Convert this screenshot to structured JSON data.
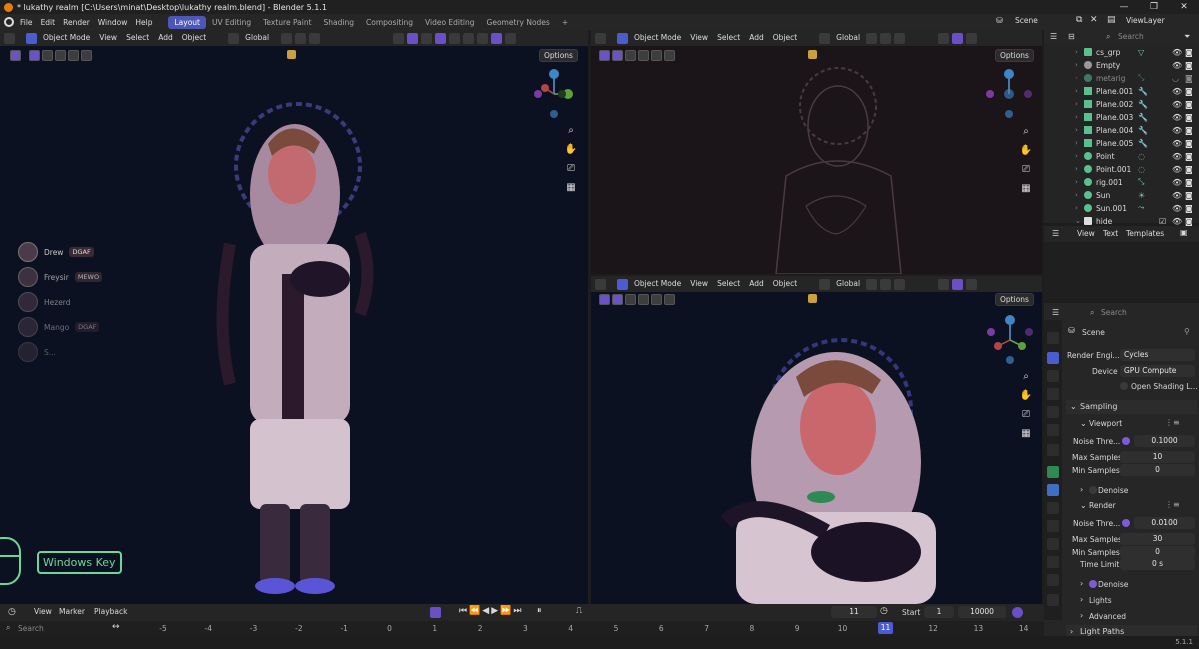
{
  "window": {
    "title": "* lukathy realm [C:\\Users\\minat\\Desktop\\lukathy realm.blend] - Blender 5.1.1",
    "min": "—",
    "max": "❐",
    "close": "✕"
  },
  "menu": {
    "items": [
      "File",
      "Edit",
      "Render",
      "Window",
      "Help"
    ]
  },
  "workspaces": [
    "Layout",
    "UV Editing",
    "Texture Paint",
    "Shading",
    "Compositing",
    "Video Editing",
    "Geometry Nodes"
  ],
  "workspace_add": "+",
  "topright": {
    "scene": "Scene",
    "viewlayer": "ViewLayer"
  },
  "viewport_header": {
    "mode": "Object Mode",
    "view": "View",
    "select": "Select",
    "add": "Add",
    "object": "Object",
    "orientation": "Global",
    "options": "Options"
  },
  "collaborators": [
    {
      "name": "Drew",
      "tag": "DGAF"
    },
    {
      "name": "Freysir",
      "tag": "MEWO"
    },
    {
      "name": "Hezerd",
      "tag": ""
    },
    {
      "name": "Mango",
      "tag": "DGAF"
    },
    {
      "name": "S...",
      "tag": ""
    }
  ],
  "overlay_key": "Windows Key",
  "outliner": {
    "search_placeholder": "Search",
    "rows": [
      "cs_grp",
      "Empty",
      "metarig",
      "Plane.001",
      "Plane.002",
      "Plane.003",
      "Plane.004",
      "Plane.005",
      "Point",
      "Point.001",
      "rig.001",
      "Sun",
      "Sun.001",
      "hide"
    ]
  },
  "text_editor": {
    "view": "View",
    "text": "Text",
    "templates": "Templates"
  },
  "properties": {
    "search_placeholder": "Search",
    "scene": "Scene",
    "render_engine_label": "Render Engi...",
    "render_engine": "Cycles",
    "device_label": "Device",
    "device": "GPU Compute",
    "osl": "Open Shading L...",
    "sampling": "Sampling",
    "viewport": "Viewport",
    "noise_label": "Noise Thre...",
    "viewport_noise": "0.1000",
    "max_samples_label": "Max Samples",
    "viewport_max": "10",
    "min_samples_label": "Min Samples",
    "viewport_min": "0",
    "denoise": "Denoise",
    "render": "Render",
    "render_noise": "0.0100",
    "render_max": "30",
    "render_min": "0",
    "time_limit_label": "Time Limit",
    "time_limit": "0 s",
    "denoise2": "Denoise",
    "lights": "Lights",
    "advanced": "Advanced",
    "light_paths": "Light Paths"
  },
  "timeline": {
    "view": "View",
    "marker": "Marker",
    "playback": "Playback",
    "current_frame": "11",
    "start_label": "Start",
    "start": "1",
    "end": "10000",
    "search_placeholder": "Search"
  },
  "ruler": {
    "ticks": [
      "-5",
      "-4",
      "-3",
      "-2",
      "-1",
      "0",
      "1",
      "2",
      "3",
      "4",
      "5",
      "6",
      "7",
      "8",
      "9",
      "10",
      "11",
      "12",
      "13",
      "14"
    ],
    "current": "11"
  },
  "status": {
    "version": "5.1.1"
  },
  "colors": {
    "accent": "#4d57b8",
    "viewport_bg": "#0d1120",
    "viewport2_bg": "#1a1418",
    "active_frame": "#4b5bd0",
    "outliner_green": "#5bc08f"
  }
}
